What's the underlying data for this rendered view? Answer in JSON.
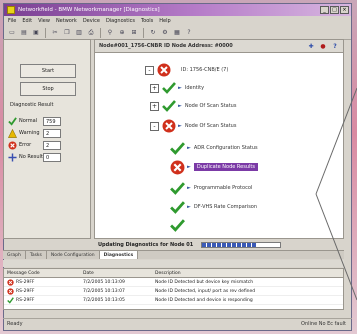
{
  "window": {
    "title": "Networkfield - BMW Networkmanager [Diagnostics]",
    "controls": [
      "_",
      "□",
      "×"
    ]
  },
  "menu": [
    "File",
    "Edit",
    "View",
    "Network",
    "Device",
    "Diagnostics",
    "Tools",
    "Help"
  ],
  "toolbar_icons": [
    "new-icon",
    "open-icon",
    "save-icon",
    "cut-icon",
    "copy-icon",
    "paste-icon",
    "print-icon",
    "find-icon",
    "zoom-icon",
    "network-icon",
    "refresh-icon",
    "settings-icon",
    "chart-icon",
    "help-icon"
  ],
  "left_panel": {
    "start_label": "Start",
    "stop_label": "Stop",
    "heading": "Diagnostic Result",
    "counts": [
      {
        "label": "Normal",
        "value": "759",
        "icon": "check-icon"
      },
      {
        "label": "Warning",
        "value": "2",
        "icon": "warning-icon"
      },
      {
        "label": "Error",
        "value": "2",
        "icon": "error-icon"
      },
      {
        "label": "No Result",
        "value": "0",
        "icon": "no-result-icon"
      }
    ]
  },
  "tree": {
    "header": "Node#001_1756-CNBR   ID Node Address: #0000",
    "nodes": [
      {
        "label": "ID: 1756-CNB/E (7)",
        "status": "error",
        "expander": "-",
        "indent": 0
      },
      {
        "label": "Identity",
        "status": "ok",
        "expander": "+",
        "indent": 1
      },
      {
        "label": "Node Of Scan Status",
        "status": "ok",
        "expander": "+",
        "indent": 1
      },
      {
        "label": "Node Of Scan Status",
        "status": "error",
        "expander": "-",
        "indent": 1
      },
      {
        "label": "ADR Configuration Status",
        "status": "ok",
        "expander": "",
        "indent": 2
      },
      {
        "label": "Duplicate Node Results",
        "status": "error",
        "expander": "",
        "indent": 2,
        "selected": true
      },
      {
        "label": "Programmable Protocol",
        "status": "ok",
        "expander": "",
        "indent": 2
      },
      {
        "label": "DF-VHS Rate Comparison",
        "status": "ok",
        "expander": "",
        "indent": 2
      },
      {
        "label": "",
        "status": "ok",
        "expander": "",
        "indent": 2
      }
    ]
  },
  "progress": {
    "label": "Updating Diagnostics for Node 01",
    "fraction": 0.7
  },
  "tabs": [
    {
      "label": "Graph",
      "active": false
    },
    {
      "label": "Tasks",
      "active": false
    },
    {
      "label": "Node Configuration",
      "active": false
    },
    {
      "label": "Diagnostics",
      "active": true
    }
  ],
  "log": {
    "headers": [
      "Message Code",
      "Date",
      "Description"
    ],
    "rows": [
      {
        "code": "RS-29FF",
        "date": "7/2/2005 10:13:09",
        "desc": "Node ID Detected but device key mismatch"
      },
      {
        "code": "RS-29FF",
        "date": "7/2/2005 10:13:07",
        "desc": "Node ID Detected, input/ port as rev defined"
      },
      {
        "code": "RS-29FF",
        "date": "7/2/2005 10:13:05",
        "desc": "Node ID Detected and device is responding"
      }
    ]
  },
  "status": {
    "left": "Ready",
    "right": "Online  No Ec  fault"
  },
  "colors": {
    "ok": "#2f9a2f",
    "error": "#d0301c",
    "warning": "#e6b800",
    "selected": "#7b3aa6",
    "accent": "#3a5ab8"
  }
}
